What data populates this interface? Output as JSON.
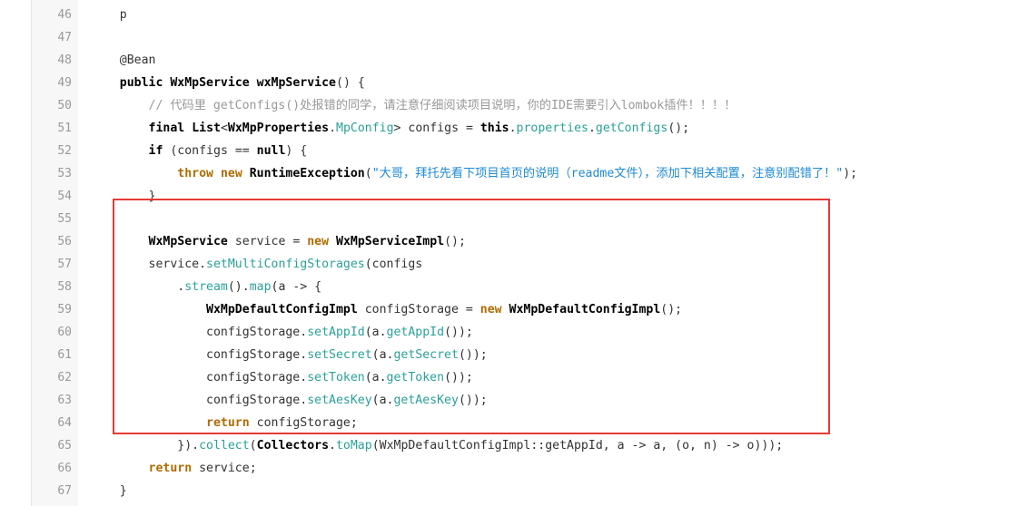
{
  "colors": {
    "highlight": "#e53935",
    "method": "#2aa198",
    "string": "#1e8ad6",
    "comment": "#999999",
    "keyword_orange": "#b06b00"
  },
  "line_numbers": [
    "46",
    "47",
    "48",
    "49",
    "50",
    "51",
    "52",
    "53",
    "54",
    "55",
    "56",
    "57",
    "58",
    "59",
    "60",
    "61",
    "62",
    "63",
    "64",
    "65",
    "66",
    "67"
  ],
  "lines": [
    [
      {
        "t": "    "
      },
      {
        "t": "p",
        "c": "tok-p"
      }
    ],
    [],
    [
      {
        "t": "    "
      },
      {
        "t": "@Bean",
        "c": "tok-ann"
      }
    ],
    [
      {
        "t": "    "
      },
      {
        "t": "public",
        "c": "tok-kw"
      },
      {
        "t": " "
      },
      {
        "t": "WxMpService",
        "c": "tok-type"
      },
      {
        "t": " "
      },
      {
        "t": "wxMpService",
        "c": "tok-type"
      },
      {
        "t": "() {"
      }
    ],
    [
      {
        "t": "        "
      },
      {
        "t": "// 代码里 getConfigs()处报错的同学，请注意仔细阅读项目说明，你的IDE需要引入lombok插件！！！！",
        "c": "tok-cmt"
      }
    ],
    [
      {
        "t": "        "
      },
      {
        "t": "final",
        "c": "tok-kw"
      },
      {
        "t": " "
      },
      {
        "t": "List",
        "c": "tok-type"
      },
      {
        "t": "<"
      },
      {
        "t": "WxMpProperties",
        "c": "tok-type"
      },
      {
        "t": "."
      },
      {
        "t": "MpConfig",
        "c": "tok-m"
      },
      {
        "t": "> configs = "
      },
      {
        "t": "this",
        "c": "tok-kw"
      },
      {
        "t": "."
      },
      {
        "t": "properties",
        "c": "tok-m"
      },
      {
        "t": "."
      },
      {
        "t": "getConfigs",
        "c": "tok-m"
      },
      {
        "t": "();"
      }
    ],
    [
      {
        "t": "        "
      },
      {
        "t": "if",
        "c": "tok-kw"
      },
      {
        "t": " (configs == "
      },
      {
        "t": "null",
        "c": "tok-kw"
      },
      {
        "t": ") {"
      }
    ],
    [
      {
        "t": "            "
      },
      {
        "t": "throw",
        "c": "tok-kwo"
      },
      {
        "t": " "
      },
      {
        "t": "new",
        "c": "tok-kwo"
      },
      {
        "t": " "
      },
      {
        "t": "RuntimeException",
        "c": "tok-type"
      },
      {
        "t": "("
      },
      {
        "t": "\"大哥，拜托先看下项目首页的说明（readme文件），添加下相关配置，注意别配错了！\"",
        "c": "tok-str"
      },
      {
        "t": ");"
      }
    ],
    [
      {
        "t": "        }"
      }
    ],
    [],
    [
      {
        "t": "        "
      },
      {
        "t": "WxMpService",
        "c": "tok-type"
      },
      {
        "t": " service = "
      },
      {
        "t": "new",
        "c": "tok-kwo"
      },
      {
        "t": " "
      },
      {
        "t": "WxMpServiceImpl",
        "c": "tok-type"
      },
      {
        "t": "();"
      }
    ],
    [
      {
        "t": "        service."
      },
      {
        "t": "setMultiConfigStorages",
        "c": "tok-m"
      },
      {
        "t": "(configs"
      }
    ],
    [
      {
        "t": "            ."
      },
      {
        "t": "stream",
        "c": "tok-m"
      },
      {
        "t": "()."
      },
      {
        "t": "map",
        "c": "tok-m"
      },
      {
        "t": "(a -> {"
      }
    ],
    [
      {
        "t": "                "
      },
      {
        "t": "WxMpDefaultConfigImpl",
        "c": "tok-type"
      },
      {
        "t": " configStorage = "
      },
      {
        "t": "new",
        "c": "tok-kwo"
      },
      {
        "t": " "
      },
      {
        "t": "WxMpDefaultConfigImpl",
        "c": "tok-type"
      },
      {
        "t": "();"
      }
    ],
    [
      {
        "t": "                configStorage."
      },
      {
        "t": "setAppId",
        "c": "tok-m"
      },
      {
        "t": "(a."
      },
      {
        "t": "getAppId",
        "c": "tok-m"
      },
      {
        "t": "());"
      }
    ],
    [
      {
        "t": "                configStorage."
      },
      {
        "t": "setSecret",
        "c": "tok-m"
      },
      {
        "t": "(a."
      },
      {
        "t": "getSecret",
        "c": "tok-m"
      },
      {
        "t": "());"
      }
    ],
    [
      {
        "t": "                configStorage."
      },
      {
        "t": "setToken",
        "c": "tok-m"
      },
      {
        "t": "(a."
      },
      {
        "t": "getToken",
        "c": "tok-m"
      },
      {
        "t": "());"
      }
    ],
    [
      {
        "t": "                configStorage."
      },
      {
        "t": "setAesKey",
        "c": "tok-m"
      },
      {
        "t": "(a."
      },
      {
        "t": "getAesKey",
        "c": "tok-m"
      },
      {
        "t": "());"
      }
    ],
    [
      {
        "t": "                "
      },
      {
        "t": "return",
        "c": "tok-kwo"
      },
      {
        "t": " configStorage;"
      }
    ],
    [
      {
        "t": "            })."
      },
      {
        "t": "collect",
        "c": "tok-m"
      },
      {
        "t": "("
      },
      {
        "t": "Collectors",
        "c": "tok-type"
      },
      {
        "t": "."
      },
      {
        "t": "toMap",
        "c": "tok-m"
      },
      {
        "t": "(WxMpDefaultConfigImpl::getAppId, a -> a, (o, n) -> o)));"
      }
    ],
    [
      {
        "t": "        "
      },
      {
        "t": "return",
        "c": "tok-kwo"
      },
      {
        "t": " service;"
      }
    ],
    [
      {
        "t": "    }"
      }
    ]
  ]
}
